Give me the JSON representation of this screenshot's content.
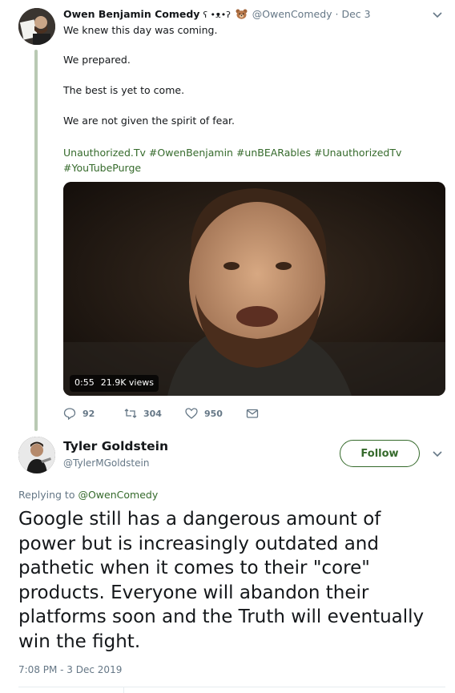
{
  "tweet1": {
    "display_name": "Owen Benjamin Comedy",
    "name_emoji": "ʕ •ᴥ•ʔ",
    "bear_icon": "bear-face-icon",
    "handle": "@OwenComedy",
    "separator": "·",
    "date": "Dec 3",
    "lines": [
      "We knew this day was coming.",
      "We prepared.",
      "The best is yet to come.",
      "We are not given the spirit of fear."
    ],
    "links": [
      "Unauthorized.Tv",
      "#OwenBenjamin",
      "#unBEARables",
      "#UnauthorizedTv",
      "#YouTubePurge"
    ],
    "video": {
      "duration": "0:55",
      "views": "21.9K views"
    },
    "actions": {
      "replies": "92",
      "retweets": "304",
      "likes": "950"
    }
  },
  "tweet2": {
    "display_name": "Tyler Goldstein",
    "handle": "@TylerMGoldstein",
    "follow_label": "Follow",
    "replying_prefix": "Replying to",
    "replying_to": "@OwenComedy",
    "text": "Google still has a dangerous amount of power but is increasingly outdated and pathetic when it comes to their \"core\" products. Everyone will abandon their platforms soon and the Truth will eventually win the fight.",
    "timestamp": "7:08 PM - 3 Dec 2019"
  },
  "colors": {
    "accent": "#356a2b",
    "secondary_text": "#657786",
    "thread_line": "#b9c9b3"
  }
}
